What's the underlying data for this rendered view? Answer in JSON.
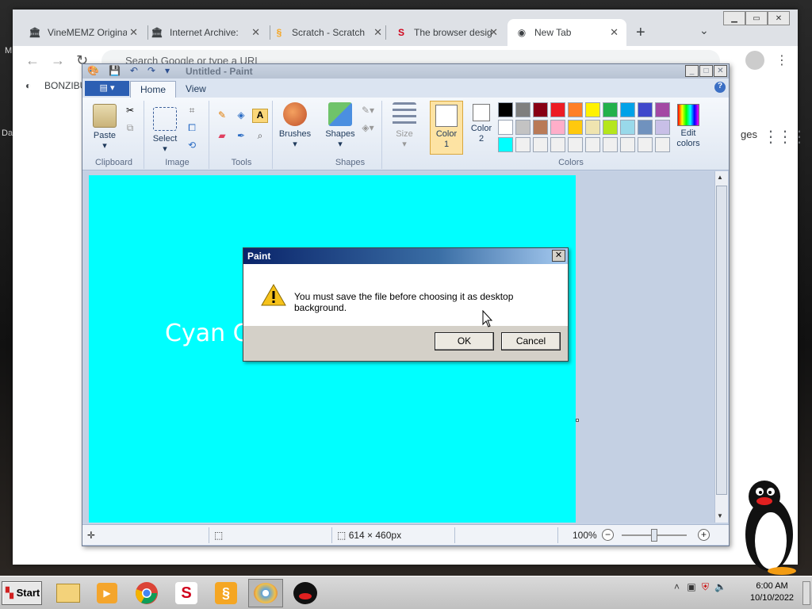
{
  "desktop": {
    "label_m": "M",
    "label_da": "Da"
  },
  "browser": {
    "tabs": [
      {
        "title": "VineMEMZ Origina",
        "icon": "archive-icon"
      },
      {
        "title": "Internet Archive:",
        "icon": "archive-icon"
      },
      {
        "title": "Scratch - Scratch",
        "icon": "scratch-icon"
      },
      {
        "title": "The browser desig",
        "icon": "scratch-s-icon"
      },
      {
        "title": "New Tab",
        "icon": "chrome-icon"
      }
    ],
    "omnibox_placeholder": "Search Google or type a URL",
    "bookmark": "BONZIBU",
    "images_link": "ges"
  },
  "paint": {
    "title": "Untitled - Paint",
    "tabs": {
      "home": "Home",
      "view": "View"
    },
    "groups": {
      "clipboard": "Clipboard",
      "image": "Image",
      "tools": "Tools",
      "shapes": "Shapes",
      "colors": "Colors"
    },
    "buttons": {
      "paste": "Paste",
      "select": "Select",
      "brushes": "Brushes",
      "shapes": "Shapes",
      "size": "Size",
      "color1_a": "Color",
      "color1_b": "1",
      "color2_a": "Color",
      "color2_b": "2",
      "edit_a": "Edit",
      "edit_b": "colors"
    },
    "palette": [
      "#000000",
      "#7f7f7f",
      "#880015",
      "#ed1c24",
      "#ff7f27",
      "#fff200",
      "#22b14c",
      "#00a2e8",
      "#3f48cc",
      "#a349a4",
      "#ffffff",
      "#c3c3c3",
      "#b97a57",
      "#ffaec9",
      "#ffc90e",
      "#efe4b0",
      "#b5e61d",
      "#99d9ea",
      "#7092be",
      "#c8bfe7",
      "#00ffff",
      "#f0f0f0",
      "#f0f0f0",
      "#f0f0f0",
      "#f0f0f0",
      "#f0f0f0",
      "#f0f0f0",
      "#f0f0f0",
      "#f0f0f0",
      "#f0f0f0"
    ],
    "canvas_color": "#00ffff",
    "canvas_text": "Cyan C",
    "status": {
      "dimensions": "614 × 460px",
      "zoom": "100%"
    }
  },
  "dialog": {
    "title": "Paint",
    "message": "You must save the file before choosing it as desktop background.",
    "ok": "OK",
    "cancel": "Cancel"
  },
  "taskbar": {
    "start": "Start",
    "time": "6:00 AM",
    "date": "10/10/2022"
  }
}
